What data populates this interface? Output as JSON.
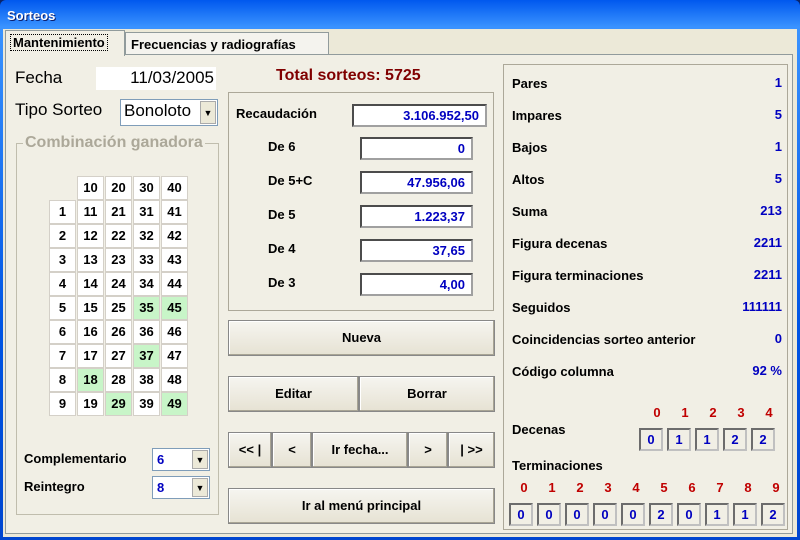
{
  "window": {
    "title": "Sorteos"
  },
  "tabs": [
    {
      "label": "Mantenimiento",
      "active": true
    },
    {
      "label": "Frecuencias y radiografías",
      "active": false
    }
  ],
  "left": {
    "fecha_label": "Fecha",
    "fecha": "11/03/2005",
    "tipo_label": "Tipo Sorteo",
    "tipo": "Bonoloto",
    "group_label": "Combinación ganadora",
    "col_headers": [
      "10",
      "20",
      "30",
      "40"
    ],
    "rows": [
      [
        "1",
        "11",
        "21",
        "31",
        "41"
      ],
      [
        "2",
        "12",
        "22",
        "32",
        "42"
      ],
      [
        "3",
        "13",
        "23",
        "33",
        "43"
      ],
      [
        "4",
        "14",
        "24",
        "34",
        "44"
      ],
      [
        "5",
        "15",
        "25",
        "35",
        "45"
      ],
      [
        "6",
        "16",
        "26",
        "36",
        "46"
      ],
      [
        "7",
        "17",
        "27",
        "37",
        "47"
      ],
      [
        "8",
        "18",
        "28",
        "38",
        "48"
      ],
      [
        "9",
        "19",
        "29",
        "39",
        "49"
      ]
    ],
    "winning": [
      "35",
      "45",
      "37",
      "18",
      "29",
      "49"
    ],
    "complementario_label": "Complementario",
    "complementario": "6",
    "reintegro_label": "Reintegro",
    "reintegro": "8"
  },
  "center": {
    "total": "Total sorteos: 5725",
    "prizes": [
      {
        "label": "Recaudación",
        "value": "3.106.952,50"
      },
      {
        "label": "De 6",
        "value": "0"
      },
      {
        "label": "De 5+C",
        "value": "47.956,06"
      },
      {
        "label": "De 5",
        "value": "1.223,37"
      },
      {
        "label": "De 4",
        "value": "37,65"
      },
      {
        "label": "De 3",
        "value": "4,00"
      }
    ],
    "buttons": {
      "nueva": "Nueva",
      "editar": "Editar",
      "borrar": "Borrar",
      "first": "<< |",
      "prev": "<",
      "ir_fecha": "Ir fecha...",
      "next": ">",
      "last": "| >>",
      "menu": "Ir al menú principal"
    }
  },
  "right": {
    "stats": [
      {
        "label": "Pares",
        "value": "1"
      },
      {
        "label": "Impares",
        "value": "5"
      },
      {
        "label": "Bajos",
        "value": "1"
      },
      {
        "label": "Altos",
        "value": "5"
      },
      {
        "label": "Suma",
        "value": "213"
      },
      {
        "label": "Figura decenas",
        "value": "2211"
      },
      {
        "label": "Figura terminaciones",
        "value": "2211"
      },
      {
        "label": "Seguidos",
        "value": "111111"
      },
      {
        "label": "Coincidencias sorteo anterior",
        "value": "0"
      },
      {
        "label": "Código columna",
        "value": "92 %"
      }
    ],
    "decenas_label": "Decenas",
    "decenas_digits": [
      "0",
      "1",
      "2",
      "3",
      "4"
    ],
    "decenas_values": [
      "0",
      "1",
      "1",
      "2",
      "2"
    ],
    "terminaciones_label": "Terminaciones",
    "term_digits": [
      "0",
      "1",
      "2",
      "3",
      "4",
      "5",
      "6",
      "7",
      "8",
      "9"
    ],
    "term_values": [
      "0",
      "0",
      "0",
      "0",
      "0",
      "2",
      "0",
      "1",
      "1",
      "2"
    ]
  },
  "colors": {
    "highlight": "#c8f5c8",
    "value": "#0000c0",
    "digit": "#c00000",
    "total": "#800000"
  }
}
